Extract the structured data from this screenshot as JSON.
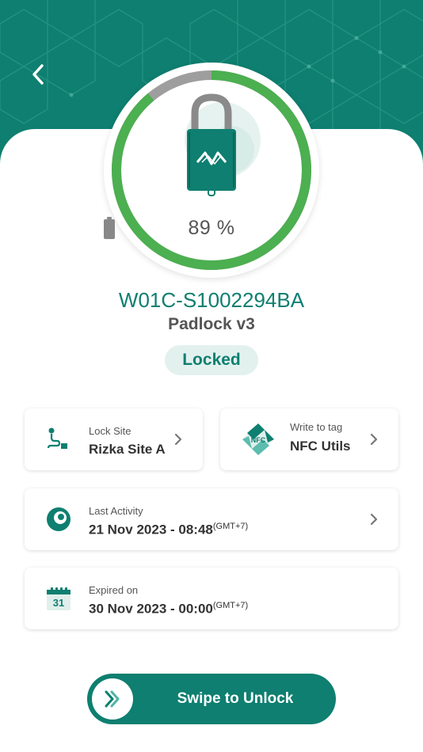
{
  "header": {
    "back_icon": "chevron-left-icon"
  },
  "device": {
    "icon": "padlock-icon",
    "battery_icon": "battery-icon",
    "battery_text": "89 %",
    "battery_level": 0.89,
    "id": "W01C-S1002294BA",
    "model": "Padlock v3",
    "status": "Locked"
  },
  "cards": {
    "lock_site": {
      "label": "Lock Site",
      "value": "Rizka Site A",
      "icon": "site-route-icon"
    },
    "nfc": {
      "label": "Write to tag",
      "value": "NFC Utils",
      "icon": "nfc-tag-icon",
      "icon_text": "NFC"
    },
    "last_activity": {
      "label": "Last Activity",
      "value": "21 Nov 2023 - 08:48",
      "tz": "(GMT+7)",
      "icon": "activity-icon"
    },
    "expired": {
      "label": "Expired on",
      "value": "30 Nov 2023 - 00:00",
      "tz": "(GMT+7)",
      "icon": "calendar-icon",
      "icon_text": "31"
    }
  },
  "swipe": {
    "label": "Swipe to Unlock",
    "icon": "double-chevron-right-icon"
  },
  "colors": {
    "primary": "#0e7f70",
    "ring_fill": "#4caf50",
    "ring_track": "#9e9e9e",
    "status_bg": "#e3f1ee"
  }
}
